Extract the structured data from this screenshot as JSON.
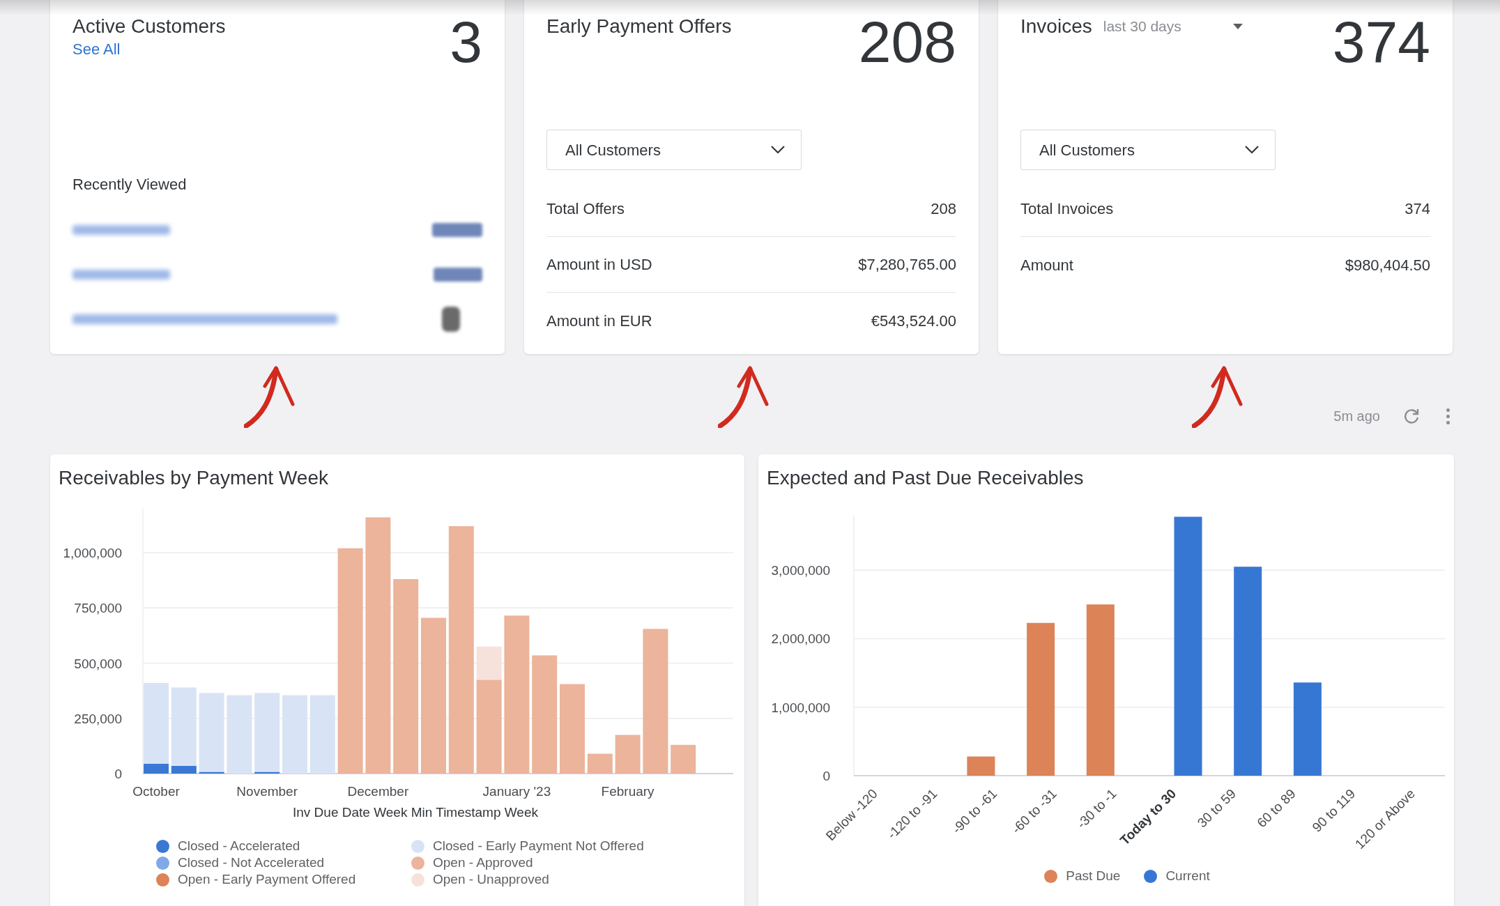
{
  "cards": [
    {
      "kind": "customers",
      "title": "Active Customers",
      "count": "3",
      "link": "See All",
      "section_label": "Recently Viewed",
      "annotated": true,
      "recent_items": [
        {
          "kind": "redacted"
        },
        {
          "kind": "redacted"
        },
        {
          "kind": "redacted"
        }
      ]
    },
    {
      "kind": "offers",
      "title": "Early Payment Offers",
      "count": "208",
      "annotated": true,
      "filter": {
        "value": "All Customers"
      },
      "rows": [
        {
          "label": "Total Offers",
          "value": "208"
        },
        {
          "label": "Amount in USD",
          "value": "$7,280,765.00"
        },
        {
          "label": "Amount in EUR",
          "value": "€543,524.00"
        }
      ]
    },
    {
      "kind": "invoices",
      "title": "Invoices",
      "period": "last 30 days",
      "count": "374",
      "annotated": true,
      "filter": {
        "value": "All Customers"
      },
      "rows": [
        {
          "label": "Total Invoices",
          "value": "374"
        },
        {
          "label": "Amount",
          "value": "$980,404.50"
        }
      ]
    }
  ],
  "toolbar": {
    "updated": "5m ago"
  },
  "charts": [
    {
      "title": "Receivables by Payment Week",
      "chart_data": {
        "type": "bar",
        "stacked": true,
        "grid": true,
        "xlabel": "Inv Due Date Week Min Timestamp Week",
        "categories": [
          "October",
          null,
          null,
          null,
          "November",
          null,
          null,
          null,
          "December",
          null,
          null,
          null,
          null,
          "January '23",
          null,
          null,
          null,
          "February",
          null,
          null
        ],
        "ylim": [
          0,
          1200000
        ],
        "yticks": [
          {
            "value": 0,
            "label": "0"
          },
          {
            "value": 250000,
            "label": "250,000"
          },
          {
            "value": 500000,
            "label": "500,000"
          },
          {
            "value": 750000,
            "label": "750,000"
          },
          {
            "value": 1000000,
            "label": "1,000,000"
          }
        ],
        "series": [
          {
            "name": "Closed - Accelerated",
            "color": "#3a78d4",
            "values": [
              45000,
              35000,
              8000,
              0,
              8000,
              0,
              0,
              0,
              0,
              0,
              0,
              0,
              0,
              0,
              0,
              0,
              0,
              0,
              0,
              0
            ]
          },
          {
            "name": "Closed - Not Accelerated",
            "color": "#80a9e6",
            "values": [
              0,
              0,
              0,
              0,
              0,
              0,
              0,
              0,
              0,
              0,
              0,
              0,
              0,
              0,
              0,
              0,
              0,
              0,
              0,
              0
            ]
          },
          {
            "name": "Open - Early Payment Offered",
            "color": "#dc8358",
            "values": [
              0,
              0,
              0,
              0,
              0,
              0,
              0,
              0,
              0,
              0,
              0,
              0,
              0,
              0,
              0,
              0,
              0,
              0,
              0,
              0
            ]
          },
          {
            "name": "Closed - Early Payment Not Offered",
            "color": "#d9e3f6",
            "values": [
              365000,
              355000,
              357000,
              355000,
              357000,
              355000,
              355000,
              0,
              0,
              0,
              0,
              0,
              0,
              0,
              0,
              0,
              0,
              0,
              0,
              0
            ]
          },
          {
            "name": "Open - Approved",
            "color": "#ebb49b",
            "values": [
              0,
              0,
              0,
              0,
              0,
              0,
              0,
              1020000,
              1160000,
              880000,
              705000,
              1120000,
              425000,
              715000,
              535000,
              405000,
              90000,
              175000,
              655000,
              130000
            ]
          },
          {
            "name": "Open - Unapproved",
            "color": "#f7e2db",
            "values": [
              0,
              0,
              0,
              0,
              0,
              0,
              0,
              0,
              0,
              0,
              0,
              0,
              150000,
              0,
              0,
              0,
              0,
              0,
              0,
              0
            ]
          }
        ]
      }
    },
    {
      "title": "Expected and Past Due Receivables",
      "label_bold": [
        false,
        false,
        false,
        false,
        false,
        true,
        false,
        false,
        false,
        false
      ],
      "chart_data": {
        "type": "bar",
        "stacked": false,
        "grid": true,
        "categories": [
          "Below -120",
          "-120 to -91",
          "-90 to -61",
          "-60 to -31",
          "-30 to -1",
          "Today to 30",
          "30 to 59",
          "60 to 89",
          "90 to 119",
          "120 or Above"
        ],
        "ylim": [
          0,
          3800000
        ],
        "yticks": [
          {
            "value": 0,
            "label": "0"
          },
          {
            "value": 1000000,
            "label": "1,000,000"
          },
          {
            "value": 2000000,
            "label": "2,000,000"
          },
          {
            "value": 3000000,
            "label": "3,000,000"
          }
        ],
        "series": [
          {
            "name": "Past Due",
            "color": "#dc8358",
            "values": [
              0,
              0,
              280000,
              2230000,
              2500000,
              0,
              0,
              0,
              0,
              0
            ]
          },
          {
            "name": "Current",
            "color": "#3677d3",
            "values": [
              0,
              0,
              0,
              0,
              0,
              3780000,
              3050000,
              1360000,
              0,
              0
            ]
          }
        ]
      }
    }
  ]
}
